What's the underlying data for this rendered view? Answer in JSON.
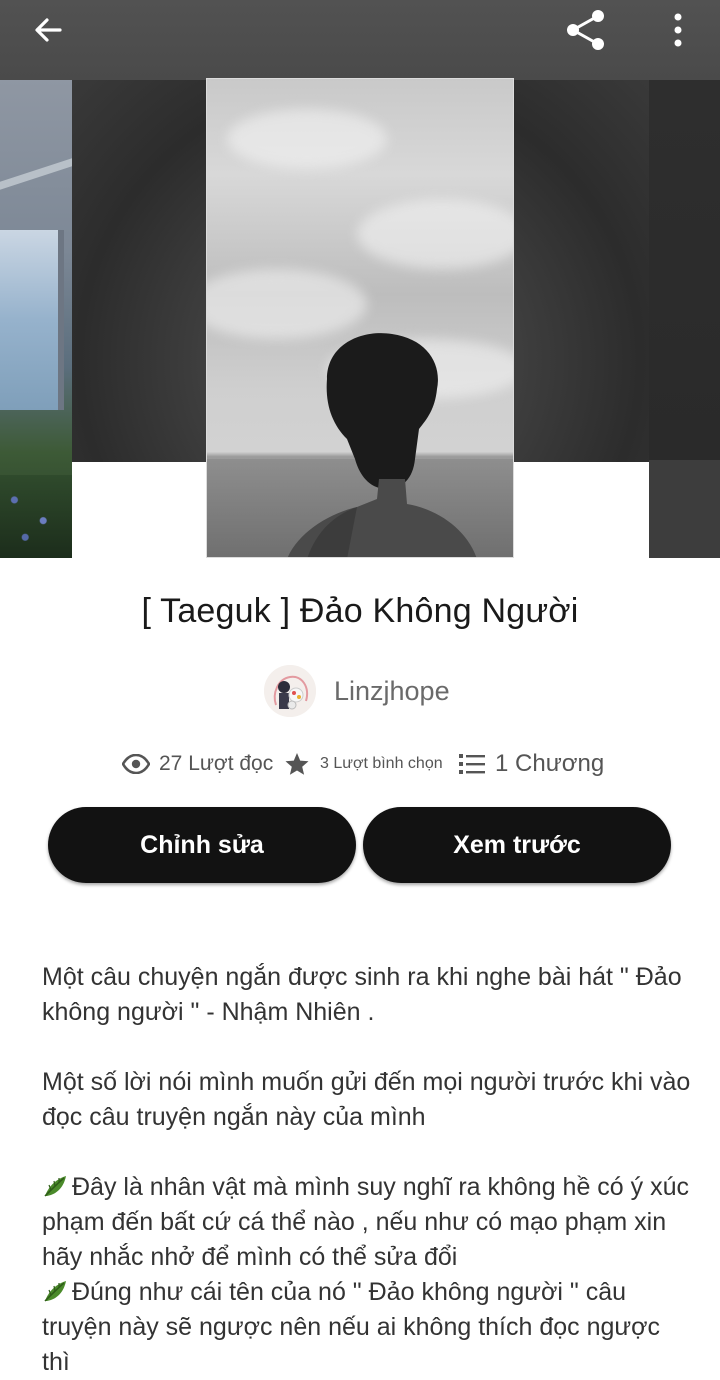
{
  "header": {
    "back_icon": "arrow-left-icon",
    "share_icon": "share-icon",
    "more_icon": "more-vertical-icon"
  },
  "story": {
    "title": "[ Taeguk ] Đảo Không Người",
    "author": "Linzjhope",
    "stats": {
      "reads": "27 Lượt đọc",
      "votes": "3 Lượt bình chọn",
      "parts": "1 Chương"
    }
  },
  "actions": {
    "edit_label": "Chỉnh sửa",
    "preview_label": "Xem trước"
  },
  "description": {
    "p1": "Một câu chuyện ngắn được sinh ra khi nghe bài hát \" Đảo không người \" - Nhậm Nhiên .",
    "p2": "Một số lời nói mình muốn gửi đến mọi người trước khi vào đọc câu truyện ngắn này của mình",
    "p3": "Đây là nhân vật mà mình suy nghĩ ra không hề có ý xúc phạm đến bất cứ cá thể nào , nếu như có mạo phạm xin hãy nhắc nhở để mình có thể sửa đổi",
    "p4": "Đúng như cái tên của nó \" Đảo không người \" câu truyện này sẽ ngược nên nếu ai không thích đọc ngược thì"
  },
  "colors": {
    "button_bg": "#121212",
    "button_text": "#ffffff",
    "leaf_green": "#4a8a2a"
  }
}
